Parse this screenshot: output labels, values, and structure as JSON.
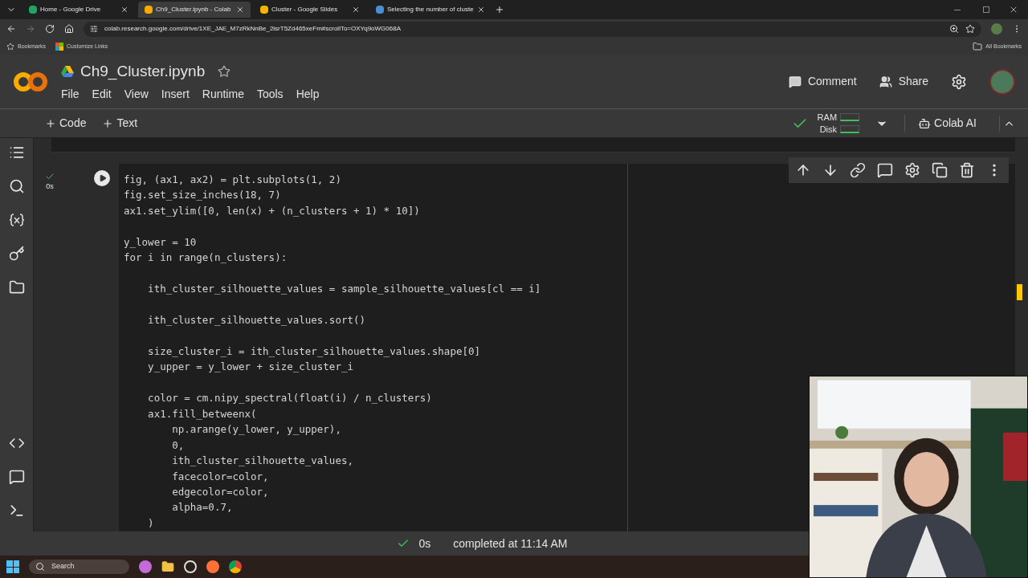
{
  "browser": {
    "tabs": [
      {
        "title": "Home - Google Drive",
        "selected": false
      },
      {
        "title": "Ch9_Cluster.ipynb - Colab",
        "selected": true
      },
      {
        "title": "Cluster - Google Slides",
        "selected": false
      },
      {
        "title": "Selecting the number of cluste",
        "selected": false
      }
    ],
    "url": "colab.research.google.com/drive/1XE_JAE_M7zRkNnBe_2isrT5Zd465xeFm#scrollTo=OXYq9oWG068A",
    "bookmarks": [
      "Bookmarks",
      "Customize Links"
    ],
    "all_bookmarks": "All Bookmarks"
  },
  "notebook": {
    "title": "Ch9_Cluster.ipynb",
    "menu": [
      "File",
      "Edit",
      "View",
      "Insert",
      "Runtime",
      "Tools",
      "Help"
    ],
    "header_actions": [
      "Comment",
      "Share"
    ],
    "toolbar": {
      "add": [
        "Code",
        "Text"
      ],
      "ram": "RAM",
      "disk": "Disk",
      "ai": "Colab AI"
    }
  },
  "cell": {
    "exec_time": "0s",
    "code_blocks": [
      [
        "fig, (ax1, ax2) = plt.subplots(1, 2)",
        "fig.set_size_inches(18, 7)",
        "ax1.set_ylim([0, len(x) + (n_clusters + 1) * 10])"
      ],
      [
        "y_lower = 10",
        "for i in range(n_clusters):"
      ],
      [
        "    ith_cluster_silhouette_values = sample_silhouette_values[cl == i]"
      ],
      [
        "    ith_cluster_silhouette_values.sort()"
      ],
      [
        "    size_cluster_i = ith_cluster_silhouette_values.shape[0]",
        "    y_upper = y_lower + size_cluster_i"
      ],
      [
        "    color = cm.nipy_spectral(float(i) / n_clusters)",
        "    ax1.fill_betweenx(",
        "        np.arange(y_lower, y_upper),",
        "        0,",
        "        ith_cluster_silhouette_values,",
        "        facecolor=color,",
        "        edgecolor=color,",
        "        alpha=0.7,",
        "    )"
      ]
    ]
  },
  "status_bar": {
    "time": "0s",
    "message": "completed at 11:14 AM"
  },
  "taskbar": {
    "search": "Search"
  }
}
